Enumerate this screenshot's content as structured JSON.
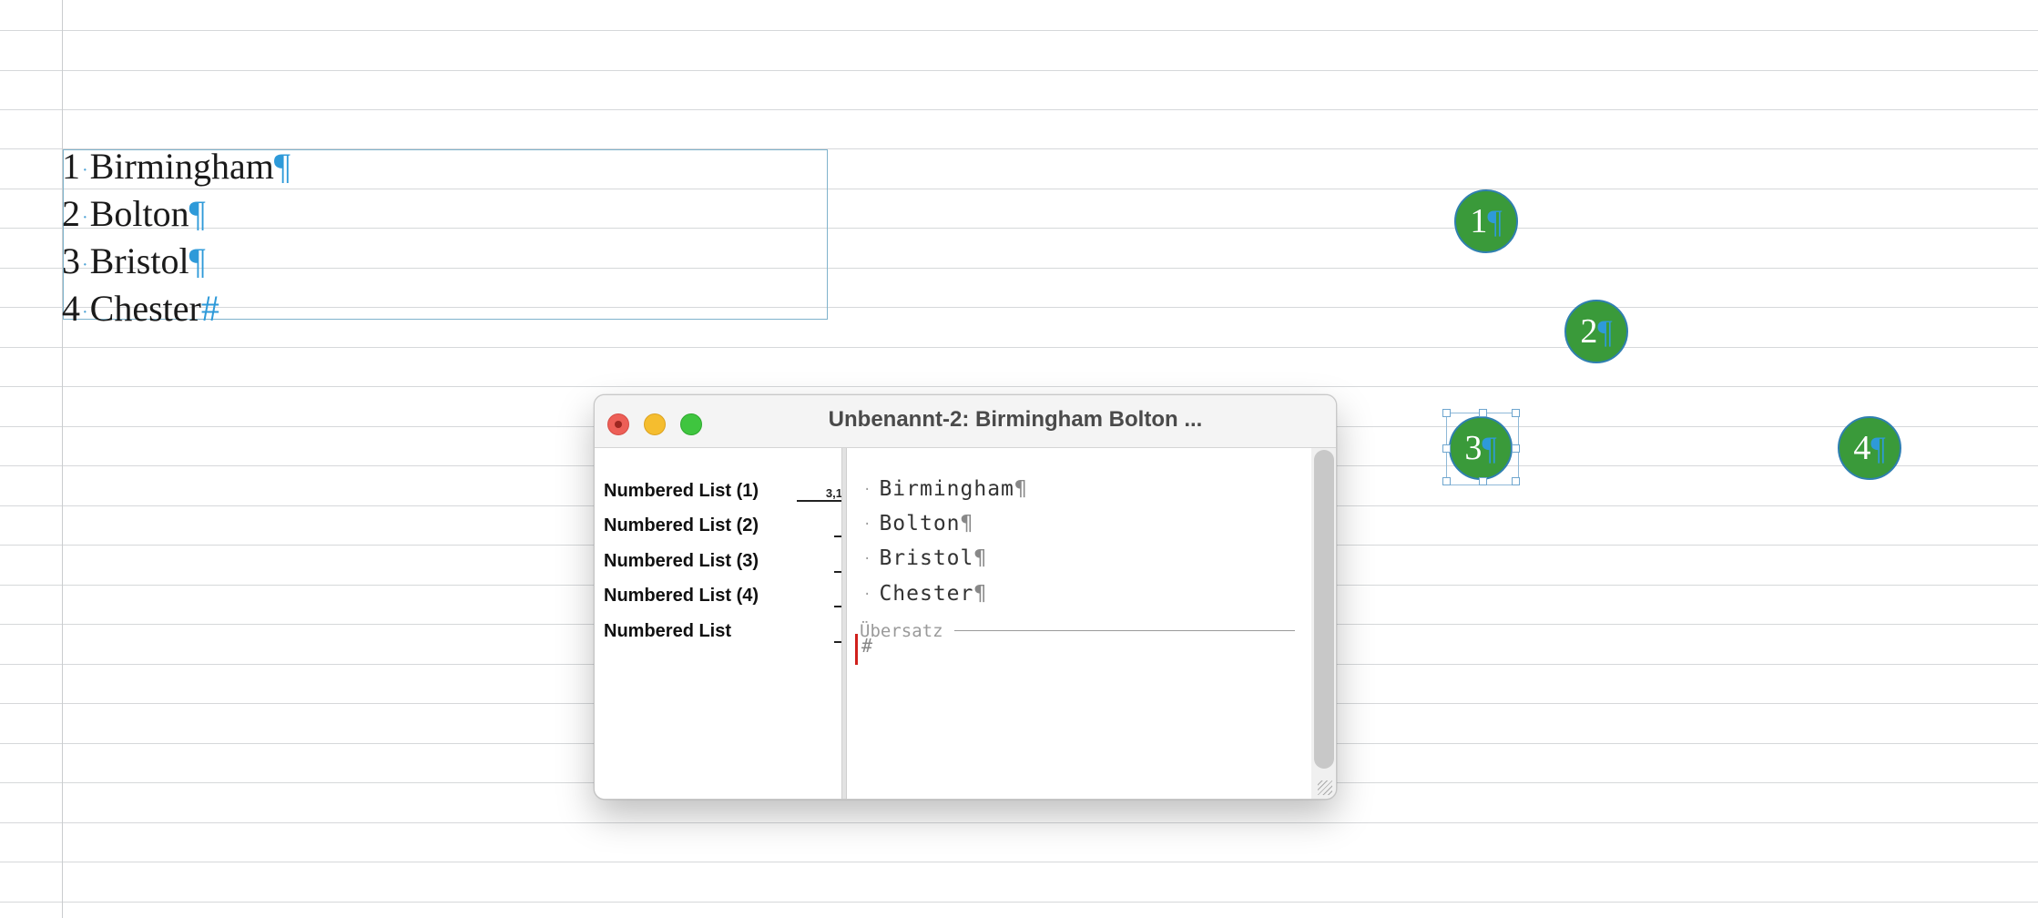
{
  "document": {
    "list_items": [
      {
        "number": "1",
        "text": "Birmingham",
        "mark": "¶"
      },
      {
        "number": "2",
        "text": "Bolton",
        "mark": "¶"
      },
      {
        "number": "3",
        "text": "Bristol",
        "mark": "¶"
      },
      {
        "number": "4",
        "text": "Chester",
        "mark": "#"
      }
    ],
    "circles": [
      {
        "number": "1",
        "mark": "¶"
      },
      {
        "number": "2",
        "mark": "¶"
      },
      {
        "number": "3",
        "mark": "¶"
      },
      {
        "number": "4",
        "mark": "¶"
      }
    ],
    "colors": {
      "circle_fill": "#3a9a3a",
      "frame_border": "#7fb3cc",
      "pilcrow": "#2e9ad9"
    }
  },
  "story_editor": {
    "title": "Unbenannt-2: Birmingham  Bolton  ...",
    "depth_indicator": "3,1",
    "styles": [
      "Numbered List (1)",
      "Numbered List (2)",
      "Numbered List (3)",
      "Numbered List (4)",
      "Numbered List"
    ],
    "lines": [
      {
        "text": "Birmingham",
        "mark": "¶"
      },
      {
        "text": "Bolton",
        "mark": "¶"
      },
      {
        "text": "Bristol",
        "mark": "¶"
      },
      {
        "text": "Chester",
        "mark": "¶"
      }
    ],
    "overset_label": "Übersatz",
    "overset_mark": "#"
  }
}
